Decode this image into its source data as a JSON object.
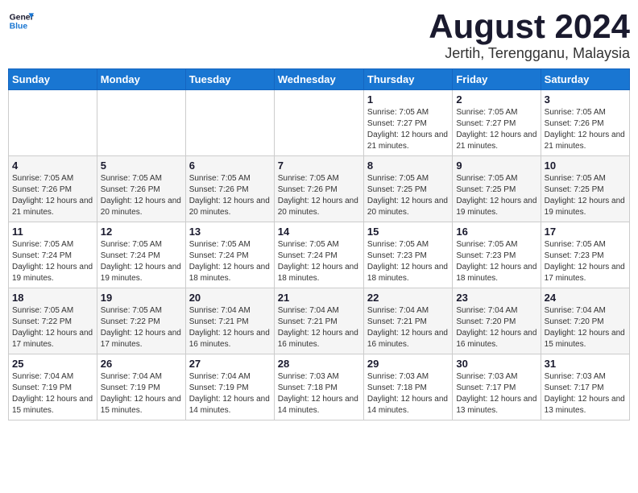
{
  "header": {
    "title": "August 2024",
    "subtitle": "Jertih, Terengganu, Malaysia",
    "logo_general": "General",
    "logo_blue": "Blue"
  },
  "days_of_week": [
    "Sunday",
    "Monday",
    "Tuesday",
    "Wednesday",
    "Thursday",
    "Friday",
    "Saturday"
  ],
  "weeks": [
    [
      {
        "day": "",
        "info": ""
      },
      {
        "day": "",
        "info": ""
      },
      {
        "day": "",
        "info": ""
      },
      {
        "day": "",
        "info": ""
      },
      {
        "day": "1",
        "info": "Sunrise: 7:05 AM\nSunset: 7:27 PM\nDaylight: 12 hours\nand 21 minutes."
      },
      {
        "day": "2",
        "info": "Sunrise: 7:05 AM\nSunset: 7:27 PM\nDaylight: 12 hours\nand 21 minutes."
      },
      {
        "day": "3",
        "info": "Sunrise: 7:05 AM\nSunset: 7:26 PM\nDaylight: 12 hours\nand 21 minutes."
      }
    ],
    [
      {
        "day": "4",
        "info": "Sunrise: 7:05 AM\nSunset: 7:26 PM\nDaylight: 12 hours\nand 21 minutes."
      },
      {
        "day": "5",
        "info": "Sunrise: 7:05 AM\nSunset: 7:26 PM\nDaylight: 12 hours\nand 20 minutes."
      },
      {
        "day": "6",
        "info": "Sunrise: 7:05 AM\nSunset: 7:26 PM\nDaylight: 12 hours\nand 20 minutes."
      },
      {
        "day": "7",
        "info": "Sunrise: 7:05 AM\nSunset: 7:26 PM\nDaylight: 12 hours\nand 20 minutes."
      },
      {
        "day": "8",
        "info": "Sunrise: 7:05 AM\nSunset: 7:25 PM\nDaylight: 12 hours\nand 20 minutes."
      },
      {
        "day": "9",
        "info": "Sunrise: 7:05 AM\nSunset: 7:25 PM\nDaylight: 12 hours\nand 19 minutes."
      },
      {
        "day": "10",
        "info": "Sunrise: 7:05 AM\nSunset: 7:25 PM\nDaylight: 12 hours\nand 19 minutes."
      }
    ],
    [
      {
        "day": "11",
        "info": "Sunrise: 7:05 AM\nSunset: 7:24 PM\nDaylight: 12 hours\nand 19 minutes."
      },
      {
        "day": "12",
        "info": "Sunrise: 7:05 AM\nSunset: 7:24 PM\nDaylight: 12 hours\nand 19 minutes."
      },
      {
        "day": "13",
        "info": "Sunrise: 7:05 AM\nSunset: 7:24 PM\nDaylight: 12 hours\nand 18 minutes."
      },
      {
        "day": "14",
        "info": "Sunrise: 7:05 AM\nSunset: 7:24 PM\nDaylight: 12 hours\nand 18 minutes."
      },
      {
        "day": "15",
        "info": "Sunrise: 7:05 AM\nSunset: 7:23 PM\nDaylight: 12 hours\nand 18 minutes."
      },
      {
        "day": "16",
        "info": "Sunrise: 7:05 AM\nSunset: 7:23 PM\nDaylight: 12 hours\nand 18 minutes."
      },
      {
        "day": "17",
        "info": "Sunrise: 7:05 AM\nSunset: 7:23 PM\nDaylight: 12 hours\nand 17 minutes."
      }
    ],
    [
      {
        "day": "18",
        "info": "Sunrise: 7:05 AM\nSunset: 7:22 PM\nDaylight: 12 hours\nand 17 minutes."
      },
      {
        "day": "19",
        "info": "Sunrise: 7:05 AM\nSunset: 7:22 PM\nDaylight: 12 hours\nand 17 minutes."
      },
      {
        "day": "20",
        "info": "Sunrise: 7:04 AM\nSunset: 7:21 PM\nDaylight: 12 hours\nand 16 minutes."
      },
      {
        "day": "21",
        "info": "Sunrise: 7:04 AM\nSunset: 7:21 PM\nDaylight: 12 hours\nand 16 minutes."
      },
      {
        "day": "22",
        "info": "Sunrise: 7:04 AM\nSunset: 7:21 PM\nDaylight: 12 hours\nand 16 minutes."
      },
      {
        "day": "23",
        "info": "Sunrise: 7:04 AM\nSunset: 7:20 PM\nDaylight: 12 hours\nand 16 minutes."
      },
      {
        "day": "24",
        "info": "Sunrise: 7:04 AM\nSunset: 7:20 PM\nDaylight: 12 hours\nand 15 minutes."
      }
    ],
    [
      {
        "day": "25",
        "info": "Sunrise: 7:04 AM\nSunset: 7:19 PM\nDaylight: 12 hours\nand 15 minutes."
      },
      {
        "day": "26",
        "info": "Sunrise: 7:04 AM\nSunset: 7:19 PM\nDaylight: 12 hours\nand 15 minutes."
      },
      {
        "day": "27",
        "info": "Sunrise: 7:04 AM\nSunset: 7:19 PM\nDaylight: 12 hours\nand 14 minutes."
      },
      {
        "day": "28",
        "info": "Sunrise: 7:03 AM\nSunset: 7:18 PM\nDaylight: 12 hours\nand 14 minutes."
      },
      {
        "day": "29",
        "info": "Sunrise: 7:03 AM\nSunset: 7:18 PM\nDaylight: 12 hours\nand 14 minutes."
      },
      {
        "day": "30",
        "info": "Sunrise: 7:03 AM\nSunset: 7:17 PM\nDaylight: 12 hours\nand 13 minutes."
      },
      {
        "day": "31",
        "info": "Sunrise: 7:03 AM\nSunset: 7:17 PM\nDaylight: 12 hours\nand 13 minutes."
      }
    ]
  ]
}
